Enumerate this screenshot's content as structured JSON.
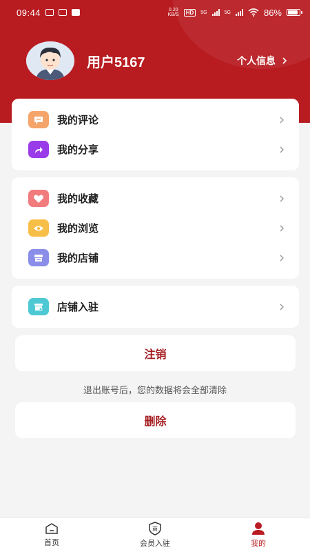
{
  "status_bar": {
    "time": "09:44",
    "net_speed_top": "0.20",
    "net_speed_bottom": "KB/S",
    "hd": "HD",
    "signal_1": "5G",
    "signal_2": "5G",
    "battery": "86%"
  },
  "colors": {
    "brand_red": "#b81c21",
    "button_text_red": "#a41e22",
    "page_bg": "#f4f4f4"
  },
  "profile": {
    "avatar_icon": "avatar-boy-icon",
    "username": "用户5167",
    "info_link": "个人信息"
  },
  "menu_groups": [
    {
      "items": [
        {
          "label": "我的评论",
          "icon": "comment-icon",
          "color": "#f5a46a"
        },
        {
          "label": "我的分享",
          "icon": "share-icon",
          "color": "#9a3bea"
        }
      ]
    },
    {
      "items": [
        {
          "label": "我的收藏",
          "icon": "heart-icon",
          "color": "#f27b7e"
        },
        {
          "label": "我的浏览",
          "icon": "eye-icon",
          "color": "#f7bf48"
        },
        {
          "label": "我的店铺",
          "icon": "store-icon",
          "color": "#8a8ee8"
        }
      ]
    },
    {
      "items": [
        {
          "label": "店铺入驻",
          "icon": "store-entry-icon",
          "color": "#4ec9d3"
        }
      ]
    }
  ],
  "actions": {
    "logout_label": "注销",
    "logout_note": "退出账号后，您的数据将会全部清除",
    "delete_label": "删除"
  },
  "tabbar": {
    "tabs": [
      {
        "label": "首页",
        "icon": "home-icon"
      },
      {
        "label": "会员入驻",
        "icon": "shield-shop-icon"
      },
      {
        "label": "我的",
        "icon": "person-icon"
      }
    ],
    "active_index": 2
  }
}
